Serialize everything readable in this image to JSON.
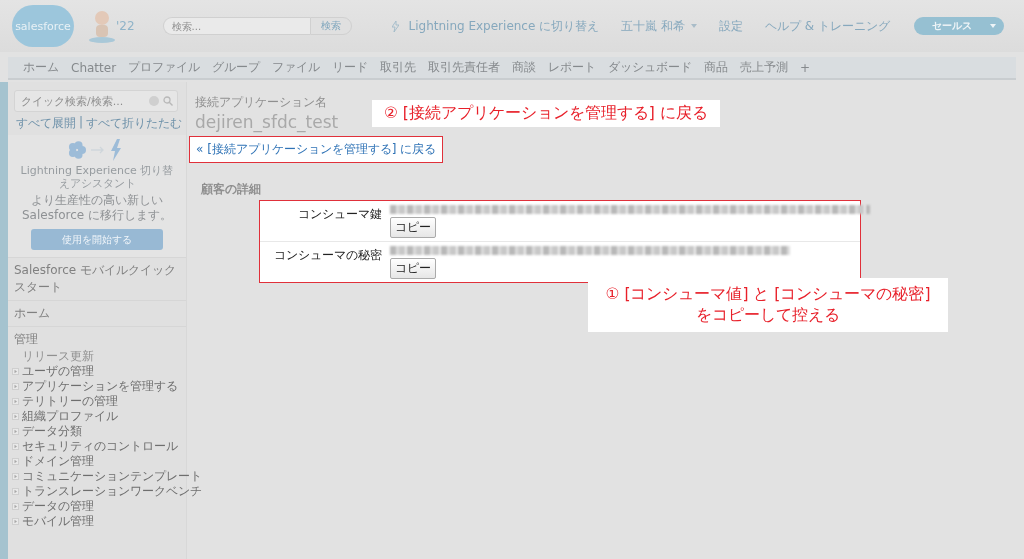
{
  "header": {
    "logo": "salesforce",
    "release_badge": "'22",
    "search": {
      "placeholder": "検索...",
      "button": "検索"
    },
    "links": [
      {
        "kind": "lightning",
        "label": "Lightning Experience に切り替え"
      },
      {
        "kind": "menu",
        "label": "五十嵐 和希"
      },
      {
        "kind": "plain",
        "label": "設定"
      },
      {
        "kind": "plain",
        "label": "ヘルプ & トレーニング"
      }
    ],
    "app_menu": "セールス"
  },
  "tabs": [
    {
      "label": "ホーム",
      "selected": false
    },
    {
      "label": "Chatter",
      "selected": false
    },
    {
      "label": "プロファイル",
      "selected": false
    },
    {
      "label": "グループ",
      "selected": false
    },
    {
      "label": "ファイル",
      "selected": false
    },
    {
      "label": "リード",
      "selected": false
    },
    {
      "label": "取引先",
      "selected": false
    },
    {
      "label": "取引先責任者",
      "selected": false
    },
    {
      "label": "商談",
      "selected": false
    },
    {
      "label": "レポート",
      "selected": false
    },
    {
      "label": "ダッシュボード",
      "selected": false
    },
    {
      "label": "商品",
      "selected": false
    },
    {
      "label": "売上予測",
      "selected": false
    },
    {
      "label": "+",
      "selected": false
    }
  ],
  "sidebar": {
    "search": {
      "placeholder": "クイック検索/検索..."
    },
    "expand_all": "すべて展開",
    "separator": "|",
    "collapse_all": "すべて折りたたむ",
    "assistant": {
      "title": "Lightning Experience 切り替えアシスタント",
      "text": "より生産性の高い新しい Salesforce に移行します。",
      "button": "使用を開始する"
    },
    "sections": [
      {
        "title": "Salesforce モバイルクイックスタート"
      },
      {
        "title": "ホーム"
      },
      {
        "title": "管理",
        "items": [
          {
            "kind": "leaf",
            "label": "リリース更新"
          },
          {
            "kind": "expandable",
            "label": "ユーザの管理"
          },
          {
            "kind": "expandable",
            "label": "アプリケーションを管理する"
          },
          {
            "kind": "expandable",
            "label": "テリトリーの管理"
          },
          {
            "kind": "expandable",
            "label": "組織プロファイル"
          },
          {
            "kind": "expandable",
            "label": "データ分類"
          },
          {
            "kind": "expandable",
            "label": "セキュリティのコントロール"
          },
          {
            "kind": "expandable",
            "label": "ドメイン管理"
          },
          {
            "kind": "expandable",
            "label": "コミュニケーションテンプレート"
          },
          {
            "kind": "expandable",
            "label": "トランスレーションワークベンチ"
          },
          {
            "kind": "expandable",
            "label": "データの管理"
          },
          {
            "kind": "expandable",
            "label": "モバイル管理"
          }
        ]
      }
    ]
  },
  "page": {
    "subtitle": "接続アプリケーション名",
    "title": "dejiren_sfdc_test",
    "back_link": "« [接続アプリケーションを管理する] に戻る",
    "section_title": "顧客の詳細",
    "fields": [
      {
        "label": "コンシューマ鍵",
        "button": "コピー"
      },
      {
        "label": "コンシューマの秘密",
        "button": "コピー"
      }
    ]
  },
  "annotations": [
    {
      "kind": "back",
      "text": "② [接続アプリケーションを管理する] に戻る"
    },
    {
      "kind": "copy",
      "lines": [
        "① [コンシューマ値] と [コンシューマの秘密]",
        "をコピーして控える"
      ]
    }
  ]
}
